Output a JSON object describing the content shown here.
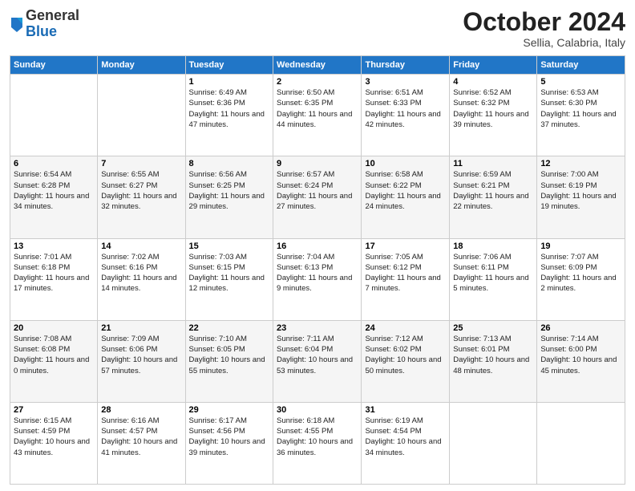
{
  "header": {
    "logo_general": "General",
    "logo_blue": "Blue",
    "month": "October 2024",
    "location": "Sellia, Calabria, Italy"
  },
  "weekdays": [
    "Sunday",
    "Monday",
    "Tuesday",
    "Wednesday",
    "Thursday",
    "Friday",
    "Saturday"
  ],
  "weeks": [
    [
      {
        "day": "",
        "info": ""
      },
      {
        "day": "",
        "info": ""
      },
      {
        "day": "1",
        "info": "Sunrise: 6:49 AM\nSunset: 6:36 PM\nDaylight: 11 hours and 47 minutes."
      },
      {
        "day": "2",
        "info": "Sunrise: 6:50 AM\nSunset: 6:35 PM\nDaylight: 11 hours and 44 minutes."
      },
      {
        "day": "3",
        "info": "Sunrise: 6:51 AM\nSunset: 6:33 PM\nDaylight: 11 hours and 42 minutes."
      },
      {
        "day": "4",
        "info": "Sunrise: 6:52 AM\nSunset: 6:32 PM\nDaylight: 11 hours and 39 minutes."
      },
      {
        "day": "5",
        "info": "Sunrise: 6:53 AM\nSunset: 6:30 PM\nDaylight: 11 hours and 37 minutes."
      }
    ],
    [
      {
        "day": "6",
        "info": "Sunrise: 6:54 AM\nSunset: 6:28 PM\nDaylight: 11 hours and 34 minutes."
      },
      {
        "day": "7",
        "info": "Sunrise: 6:55 AM\nSunset: 6:27 PM\nDaylight: 11 hours and 32 minutes."
      },
      {
        "day": "8",
        "info": "Sunrise: 6:56 AM\nSunset: 6:25 PM\nDaylight: 11 hours and 29 minutes."
      },
      {
        "day": "9",
        "info": "Sunrise: 6:57 AM\nSunset: 6:24 PM\nDaylight: 11 hours and 27 minutes."
      },
      {
        "day": "10",
        "info": "Sunrise: 6:58 AM\nSunset: 6:22 PM\nDaylight: 11 hours and 24 minutes."
      },
      {
        "day": "11",
        "info": "Sunrise: 6:59 AM\nSunset: 6:21 PM\nDaylight: 11 hours and 22 minutes."
      },
      {
        "day": "12",
        "info": "Sunrise: 7:00 AM\nSunset: 6:19 PM\nDaylight: 11 hours and 19 minutes."
      }
    ],
    [
      {
        "day": "13",
        "info": "Sunrise: 7:01 AM\nSunset: 6:18 PM\nDaylight: 11 hours and 17 minutes."
      },
      {
        "day": "14",
        "info": "Sunrise: 7:02 AM\nSunset: 6:16 PM\nDaylight: 11 hours and 14 minutes."
      },
      {
        "day": "15",
        "info": "Sunrise: 7:03 AM\nSunset: 6:15 PM\nDaylight: 11 hours and 12 minutes."
      },
      {
        "day": "16",
        "info": "Sunrise: 7:04 AM\nSunset: 6:13 PM\nDaylight: 11 hours and 9 minutes."
      },
      {
        "day": "17",
        "info": "Sunrise: 7:05 AM\nSunset: 6:12 PM\nDaylight: 11 hours and 7 minutes."
      },
      {
        "day": "18",
        "info": "Sunrise: 7:06 AM\nSunset: 6:11 PM\nDaylight: 11 hours and 5 minutes."
      },
      {
        "day": "19",
        "info": "Sunrise: 7:07 AM\nSunset: 6:09 PM\nDaylight: 11 hours and 2 minutes."
      }
    ],
    [
      {
        "day": "20",
        "info": "Sunrise: 7:08 AM\nSunset: 6:08 PM\nDaylight: 11 hours and 0 minutes."
      },
      {
        "day": "21",
        "info": "Sunrise: 7:09 AM\nSunset: 6:06 PM\nDaylight: 10 hours and 57 minutes."
      },
      {
        "day": "22",
        "info": "Sunrise: 7:10 AM\nSunset: 6:05 PM\nDaylight: 10 hours and 55 minutes."
      },
      {
        "day": "23",
        "info": "Sunrise: 7:11 AM\nSunset: 6:04 PM\nDaylight: 10 hours and 53 minutes."
      },
      {
        "day": "24",
        "info": "Sunrise: 7:12 AM\nSunset: 6:02 PM\nDaylight: 10 hours and 50 minutes."
      },
      {
        "day": "25",
        "info": "Sunrise: 7:13 AM\nSunset: 6:01 PM\nDaylight: 10 hours and 48 minutes."
      },
      {
        "day": "26",
        "info": "Sunrise: 7:14 AM\nSunset: 6:00 PM\nDaylight: 10 hours and 45 minutes."
      }
    ],
    [
      {
        "day": "27",
        "info": "Sunrise: 6:15 AM\nSunset: 4:59 PM\nDaylight: 10 hours and 43 minutes."
      },
      {
        "day": "28",
        "info": "Sunrise: 6:16 AM\nSunset: 4:57 PM\nDaylight: 10 hours and 41 minutes."
      },
      {
        "day": "29",
        "info": "Sunrise: 6:17 AM\nSunset: 4:56 PM\nDaylight: 10 hours and 39 minutes."
      },
      {
        "day": "30",
        "info": "Sunrise: 6:18 AM\nSunset: 4:55 PM\nDaylight: 10 hours and 36 minutes."
      },
      {
        "day": "31",
        "info": "Sunrise: 6:19 AM\nSunset: 4:54 PM\nDaylight: 10 hours and 34 minutes."
      },
      {
        "day": "",
        "info": ""
      },
      {
        "day": "",
        "info": ""
      }
    ]
  ]
}
